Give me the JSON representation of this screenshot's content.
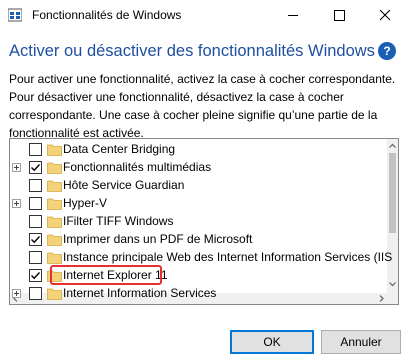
{
  "window": {
    "title": "Fonctionnalités de Windows",
    "title_icon": "windows-features-icon"
  },
  "heading": "Activer ou désactiver des fonctionnalités Windows",
  "help_icon": "?",
  "description": "Pour activer une fonctionnalité, activez la case à cocher correspondante. Pour désactiver une fonctionnalité, désactivez la case à cocher correspondante. Une case à cocher pleine signifie qu’une partie de la fonctionnalité est activée.",
  "features": [
    {
      "label": "Data Center Bridging",
      "state": "unchecked",
      "expandable": false
    },
    {
      "label": "Fonctionnalités multimédias",
      "state": "checked",
      "expandable": true
    },
    {
      "label": "Hôte Service Guardian",
      "state": "unchecked",
      "expandable": false
    },
    {
      "label": "Hyper-V",
      "state": "unchecked",
      "expandable": true
    },
    {
      "label": "IFilter TIFF Windows",
      "state": "unchecked",
      "expandable": false
    },
    {
      "label": "Imprimer dans un PDF de Microsoft",
      "state": "checked",
      "expandable": false
    },
    {
      "label": "Instance principale Web des Internet Information Services (IIS",
      "state": "unchecked",
      "expandable": false
    },
    {
      "label": "Internet Explorer 11",
      "state": "checked",
      "expandable": false,
      "highlighted": true
    },
    {
      "label": "Internet Information Services",
      "state": "unchecked",
      "expandable": true
    }
  ],
  "buttons": {
    "ok": "OK",
    "cancel": "Annuler"
  },
  "colors": {
    "heading": "#1e4fa0",
    "highlight_border": "#e8302e",
    "folder": "#f4d27a",
    "default_button_border": "#0078d7"
  }
}
